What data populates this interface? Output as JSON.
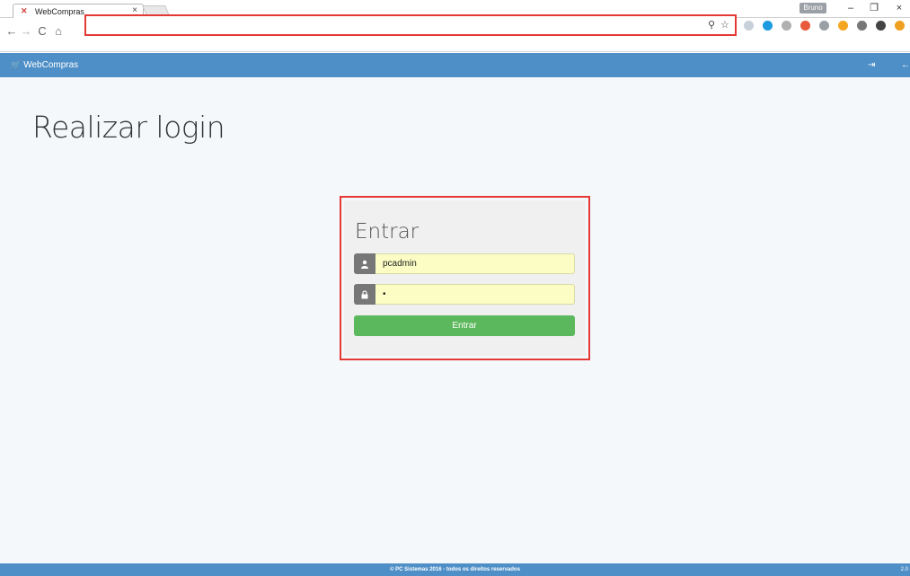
{
  "browser": {
    "tab_title": "WebCompras",
    "tab_close": "×",
    "profile_name": "Bruno",
    "minimize": "–",
    "restore": "❐",
    "close": "×",
    "address_value": "",
    "back": "←",
    "forward": "→",
    "reload": "C",
    "home": "⌂",
    "key_icon": "⚲",
    "star_icon": "☆",
    "extensions": [
      "#c8d0da",
      "#1e9be0",
      "#b0b0b0",
      "#e85a3c",
      "#9aa0a6",
      "#f5a623",
      "#777777",
      "#444444",
      "#f0a020"
    ]
  },
  "navbar": {
    "brand_icon": "🛒",
    "brand": "WebCompras",
    "color": "#4f8fc7"
  },
  "page": {
    "title": "Realizar login"
  },
  "login": {
    "heading": "Entrar",
    "username_value": "pcadmin",
    "password_value": "•",
    "user_icon": "👤",
    "lock_icon": "🔒",
    "submit_label": "Entrar",
    "submit_color": "#5cb85c"
  },
  "footer": {
    "text": "© PC Sistemas 2016 - todos os direitos reservados",
    "version": "2.0"
  }
}
